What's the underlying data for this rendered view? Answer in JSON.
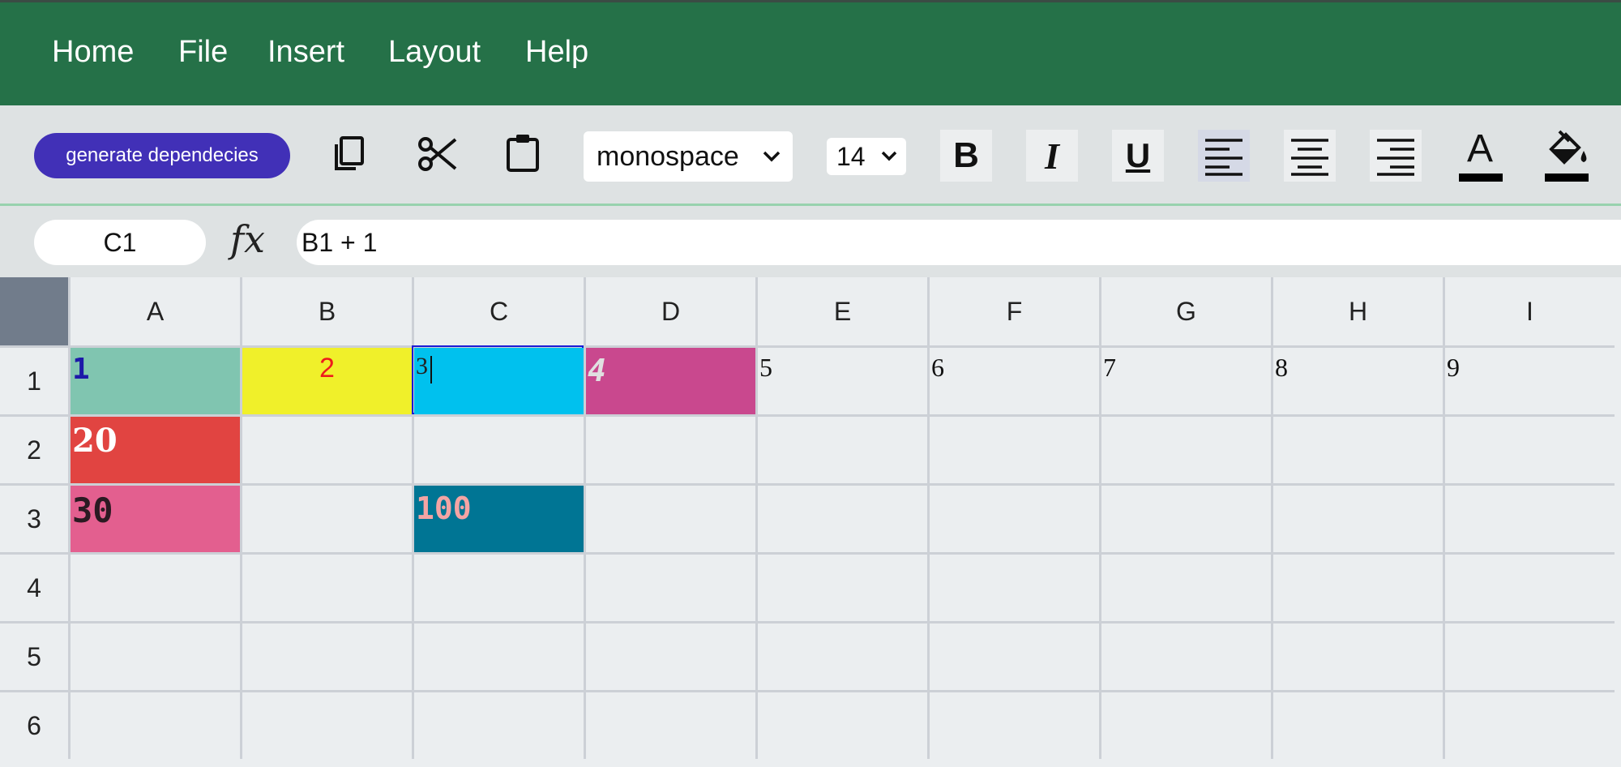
{
  "menu": {
    "items": [
      "Home",
      "File",
      "Insert",
      "Layout",
      "Help"
    ]
  },
  "toolbar": {
    "generate_label": "generate dependecies",
    "font_family": "monospace",
    "font_size": "14",
    "icons": [
      "copy-icon",
      "cut-icon",
      "paste-icon",
      "bold-icon",
      "italic-icon",
      "underline-icon",
      "align-left-icon",
      "align-center-icon",
      "align-right-icon",
      "text-color-icon",
      "fill-color-icon"
    ],
    "bold_glyph": "B",
    "italic_glyph": "I",
    "underline_glyph": "U",
    "text_color_glyph": "A"
  },
  "formula_bar": {
    "cell_ref": "C1",
    "fx_label": "fx",
    "formula": "B1 + 1"
  },
  "grid": {
    "columns": [
      "A",
      "B",
      "C",
      "D",
      "E",
      "F",
      "G",
      "H",
      "I"
    ],
    "rows": [
      "1",
      "2",
      "3",
      "4",
      "5",
      "6"
    ],
    "selected_cell": "C1",
    "cells": {
      "A1": {
        "value": "1",
        "bg": "#80c5b0",
        "color": "#1d19a8"
      },
      "B1": {
        "value": "2",
        "bg": "#f0f02a",
        "color": "#ee1c1c"
      },
      "C1": {
        "value": "3",
        "bg": "#00c1ee",
        "color": "#222222"
      },
      "D1": {
        "value": "4",
        "bg": "#c9488e",
        "color": "#e0e0e0"
      },
      "E1": {
        "value": "5"
      },
      "F1": {
        "value": "6"
      },
      "G1": {
        "value": "7"
      },
      "H1": {
        "value": "8"
      },
      "I1": {
        "value": "9"
      },
      "A2": {
        "value": "20",
        "bg": "#e14441",
        "color": "#ffffff"
      },
      "A3": {
        "value": "30",
        "bg": "#e35f8f",
        "color": "#2b1a22"
      },
      "C3": {
        "value": "100",
        "bg": "#007594",
        "color": "#f4a4a4"
      }
    }
  },
  "colors": {
    "menu_bg": "#257148",
    "toolbar_bg": "#dee2e3",
    "accent_button": "#4130b7",
    "selection_border": "#1a1ad6"
  }
}
